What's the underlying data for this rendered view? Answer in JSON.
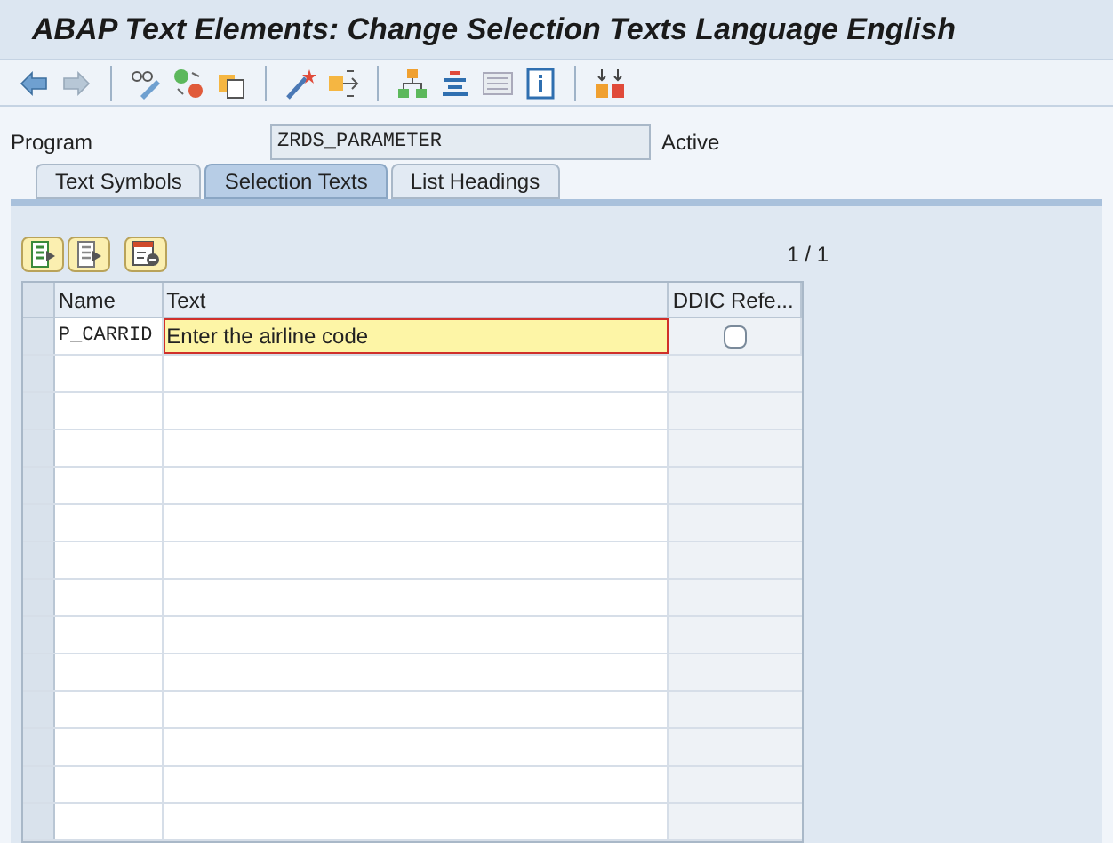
{
  "window": {
    "title": "ABAP Text Elements: Change Selection Texts Language English"
  },
  "program": {
    "label": "Program",
    "value": "ZRDS_PARAMETER",
    "status": "Active"
  },
  "tabs": [
    {
      "label": "Text Symbols",
      "selected": false
    },
    {
      "label": "Selection Texts",
      "selected": true
    },
    {
      "label": "List Headings",
      "selected": false
    }
  ],
  "page_indicator": "1 / 1",
  "table": {
    "columns": [
      "Name",
      "Text",
      "DDIC Refe..."
    ],
    "rows": [
      {
        "name": "P_CARRID",
        "text": "Enter the airline code",
        "ddic_reference": false,
        "editing": true
      }
    ]
  }
}
